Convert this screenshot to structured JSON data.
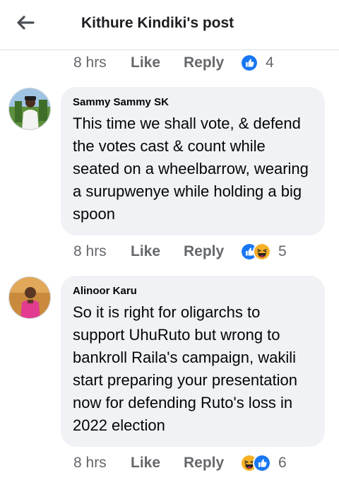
{
  "header": {
    "title": "Kithure Kindiki's post",
    "back_icon": "arrow-left-icon"
  },
  "top_actions": {
    "time": "8 hrs",
    "like": "Like",
    "reply": "Reply",
    "reaction_count": "4",
    "reactions": [
      "like"
    ]
  },
  "comments": [
    {
      "author": "Sammy Sammy SK",
      "text": "This time we shall vote, & defend the votes cast & count while seated on a wheelbarrow, wearing a surupwenye while holding a big spoon",
      "time": "8 hrs",
      "like": "Like",
      "reply": "Reply",
      "reactions": [
        "like",
        "haha"
      ],
      "reaction_count": "5"
    },
    {
      "author": "Alinoor Karu",
      "text": "So it is right for oligarchs to support UhuRuto but wrong to bankroll Raila's campaign, wakili start preparing your presentation now for defending Ruto's loss in 2022 election",
      "time": "8 hrs",
      "like": "Like",
      "reply": "Reply",
      "reactions": [
        "haha",
        "like"
      ],
      "reaction_count": "6"
    }
  ],
  "colors": {
    "like_blue": "#1877f2",
    "haha_yellow": "#f7b125",
    "bubble_bg": "#f0f2f5",
    "meta_gray": "#65676b"
  }
}
